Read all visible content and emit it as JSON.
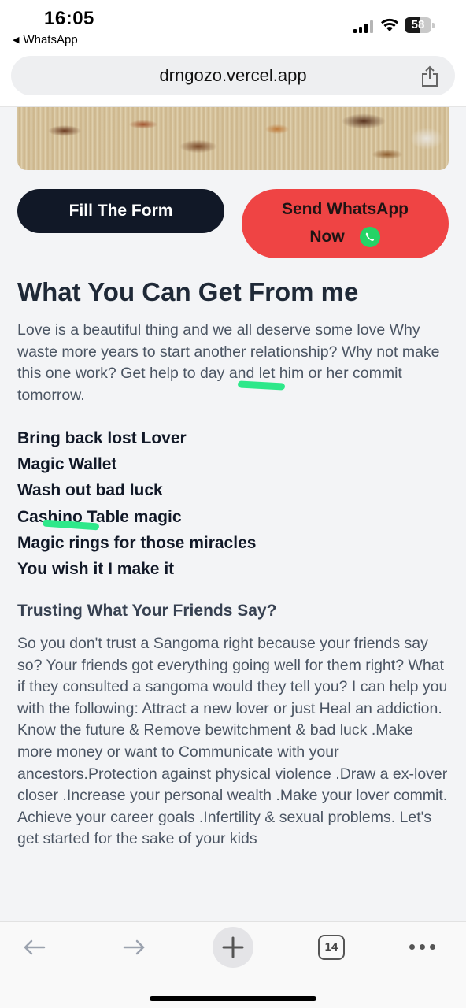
{
  "status_bar": {
    "time": "16:05",
    "back_app": "WhatsApp",
    "battery_percent": "58",
    "battery_level": 0.58
  },
  "browser": {
    "url": "drngozo.vercel.app",
    "tab_count": "14"
  },
  "hero": {
    "buttons": {
      "fill_form": "Fill The Form",
      "send_whatsapp_line1": "Send WhatsApp",
      "send_whatsapp_line2": "Now"
    }
  },
  "main": {
    "title": "What You Can Get From me",
    "intro": "Love is a beautiful thing and we all deserve some love Why waste more years to start another relationship? Why not make this one work? Get help to day and let him or her commit tomorrow.",
    "services": [
      "Bring back lost Lover",
      "Magic Wallet",
      "Wash out bad luck",
      "Cashino Table magic",
      "Magic rings for those miracles",
      "You wish it I make it"
    ],
    "subtitle": "Trusting What Your Friends Say?",
    "paragraph": "So you don't trust a Sangoma right because your friends say so? Your friends got everything going well for them right? What if they consulted a sangoma would they tell you? I can help you with the following: Attract a new lover or just Heal an addiction. Know the future & Remove bewitchment & bad luck .Make more money or want to Communicate with your ancestors.Protection against physical violence .Draw a ex-lover closer .Increase your personal wealth .Make your lover commit. Achieve your career goals .Infertility & sexual problems. Let's get started for the sake of your kids"
  },
  "colors": {
    "dark_button": "#111827",
    "whatsapp_button": "#ef4444",
    "whatsapp_green": "#25d366",
    "highlight_marker": "#2ee88a"
  }
}
